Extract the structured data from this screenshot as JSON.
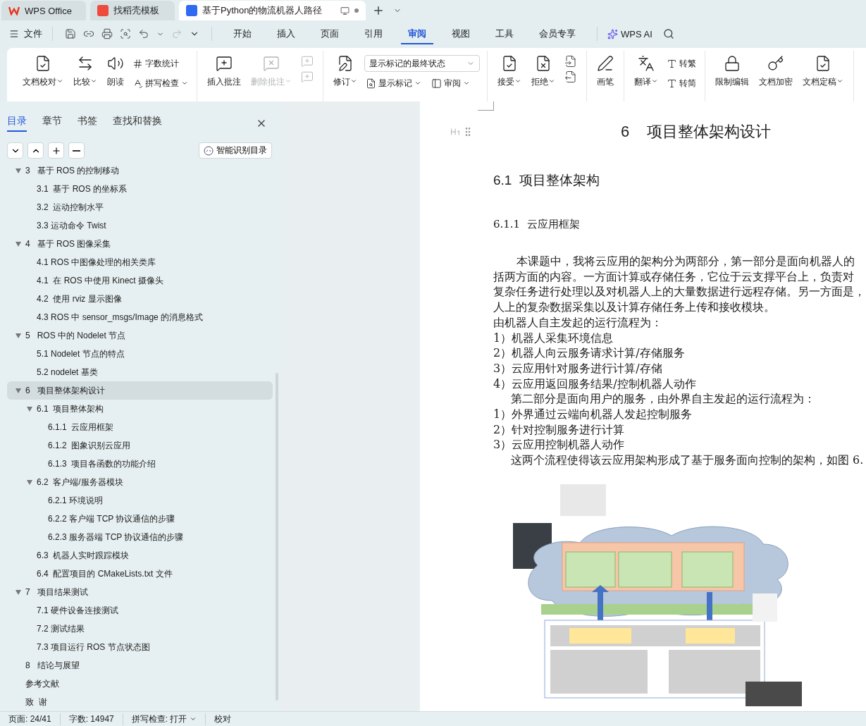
{
  "title_tabs": [
    {
      "kind": "home",
      "label": "WPS Office",
      "selected": false
    },
    {
      "kind": "template",
      "label": "找稻壳模板",
      "selected": false
    },
    {
      "kind": "document",
      "label": "基于Python的物流机器人路径",
      "selected": true
    }
  ],
  "menu": {
    "file": "文件",
    "tabs": [
      {
        "label": "开始",
        "selected": false
      },
      {
        "label": "插入",
        "selected": false
      },
      {
        "label": "页面",
        "selected": false
      },
      {
        "label": "引用",
        "selected": false
      },
      {
        "label": "审阅",
        "selected": true
      },
      {
        "label": "视图",
        "selected": false
      },
      {
        "label": "工具",
        "selected": false
      },
      {
        "label": "会员专享",
        "selected": false
      }
    ],
    "ai": "WPS AI"
  },
  "ribbon": [
    {
      "items": [
        {
          "kind": "large",
          "label": "文档校对",
          "dropdown": true,
          "disabled": false
        },
        {
          "kind": "large",
          "label": "比较",
          "dropdown": true,
          "disabled": false
        },
        {
          "kind": "large",
          "label": "朗读",
          "dropdown": false,
          "disabled": false
        },
        {
          "kind": "stack",
          "items": [
            {
              "kind": "small",
              "label": "字数统计",
              "dropdown": false,
              "disabled": false
            },
            {
              "kind": "small",
              "label": "拼写检查",
              "dropdown": true,
              "disabled": false
            }
          ]
        }
      ]
    },
    {
      "items": [
        {
          "kind": "large",
          "label": "插入批注",
          "dropdown": false,
          "disabled": false
        },
        {
          "kind": "large",
          "label": "删除批注",
          "dropdown": true,
          "disabled": true
        },
        {
          "kind": "stack",
          "items": [
            {
              "kind": "icon",
              "disabled": true
            },
            {
              "kind": "icon",
              "disabled": true
            }
          ]
        }
      ]
    },
    {
      "items": [
        {
          "kind": "large",
          "label": "修订",
          "dropdown": true,
          "disabled": false
        },
        {
          "kind": "stack",
          "items": [
            {
              "kind": "select",
              "label": "显示标记的最终状态"
            },
            {
              "kind": "row",
              "items": [
                {
                  "kind": "small",
                  "label": "显示标记",
                  "dropdown": true,
                  "disabled": false
                },
                {
                  "kind": "small",
                  "label": "审阅",
                  "dropdown": true,
                  "disabled": false
                }
              ]
            }
          ]
        }
      ]
    },
    {
      "items": [
        {
          "kind": "large",
          "label": "接受",
          "dropdown": true,
          "disabled": false
        },
        {
          "kind": "large",
          "label": "拒绝",
          "dropdown": true,
          "disabled": false
        },
        {
          "kind": "stack",
          "items": [
            {
              "kind": "icon",
              "disabled": false
            },
            {
              "kind": "icon",
              "disabled": false
            }
          ]
        }
      ]
    },
    {
      "items": [
        {
          "kind": "large",
          "label": "画笔",
          "dropdown": false,
          "disabled": false
        }
      ]
    },
    {
      "items": [
        {
          "kind": "large",
          "label": "翻译",
          "dropdown": true,
          "disabled": false
        },
        {
          "kind": "stack",
          "items": [
            {
              "kind": "small",
              "label": "转繁",
              "dropdown": false,
              "disabled": false
            },
            {
              "kind": "small",
              "label": "转简",
              "dropdown": false,
              "disabled": false
            }
          ]
        }
      ]
    },
    {
      "items": [
        {
          "kind": "large",
          "label": "限制编辑",
          "dropdown": false,
          "disabled": false
        },
        {
          "kind": "large",
          "label": "文档加密",
          "dropdown": false,
          "disabled": false
        },
        {
          "kind": "large",
          "label": "文档定稿",
          "dropdown": true,
          "disabled": false
        }
      ]
    }
  ],
  "sidebar": {
    "tabs": [
      {
        "label": "目录",
        "selected": true
      },
      {
        "label": "章节",
        "selected": false
      },
      {
        "label": "书签",
        "selected": false
      },
      {
        "label": "查找和替换",
        "selected": false
      }
    ],
    "smart_button": "智能识别目录",
    "outline": [
      {
        "label": "3   基于 ROS 的控制移动",
        "selected": false,
        "expanded": true,
        "children": [
          {
            "label": "3.1  基于 ROS 的坐标系",
            "selected": false
          },
          {
            "label": "3.2  运动控制水平",
            "selected": false
          },
          {
            "label": "3.3 运动命令 Twist",
            "selected": false
          }
        ]
      },
      {
        "label": "4   基于 ROS 图像采集",
        "selected": false,
        "expanded": true,
        "children": [
          {
            "label": "4.1 ROS 中图像处理的相关类库",
            "selected": false
          },
          {
            "label": "4.1  在 ROS 中使用 Kinect 摄像头",
            "selected": false
          },
          {
            "label": "4.2  使用 rviz 显示图像",
            "selected": false
          },
          {
            "label": "4.3 ROS 中 sensor_msgs/Image 的消息格式",
            "selected": false
          }
        ]
      },
      {
        "label": "5   ROS 中的 Nodelet 节点",
        "selected": false,
        "expanded": true,
        "children": [
          {
            "label": "5.1 Nodelet 节点的特点",
            "selected": false
          },
          {
            "label": "5.2 nodelet 基类",
            "selected": false
          }
        ]
      },
      {
        "label": "6   项目整体架构设计",
        "selected": true,
        "expanded": true,
        "children": [
          {
            "label": "6.1  项目整体架构",
            "selected": false,
            "expanded": true,
            "children": [
              {
                "label": "6.1.1  云应用框架",
                "selected": false
              },
              {
                "label": "6.1.2  图象识别云应用",
                "selected": false
              },
              {
                "label": "6.1.3  项目各函数的功能介绍",
                "selected": false
              }
            ]
          },
          {
            "label": "6.2  客户端/服务器模块",
            "selected": false,
            "expanded": true,
            "children": [
              {
                "label": "6.2.1 环境说明",
                "selected": false
              },
              {
                "label": "6.2.2 客户端 TCP 协议通信的步骤",
                "selected": false
              },
              {
                "label": "6.2.3 服务器端 TCP 协议通信的步骤",
                "selected": false
              }
            ]
          },
          {
            "label": "6.3  机器人实时跟踪模块",
            "selected": false
          },
          {
            "label": "6.4  配置项目的 CMakeLists.txt 文件",
            "selected": false
          }
        ]
      },
      {
        "label": "7   项目结果测试",
        "selected": false,
        "expanded": true,
        "children": [
          {
            "label": "7.1 硬件设备连接测试",
            "selected": false
          },
          {
            "label": "7.2 测试结果",
            "selected": false
          },
          {
            "label": "7.3 项目运行 ROS 节点状态图",
            "selected": false
          }
        ]
      },
      {
        "label": "8   结论与展望",
        "selected": false
      },
      {
        "label": "参考文献",
        "selected": false
      },
      {
        "label": "致  谢",
        "selected": false
      }
    ]
  },
  "document": {
    "chapter_title": "6    项目整体架构设计",
    "section_title": "6.1  项目整体架构",
    "subsection_title": "6.1.1  云应用框架",
    "lines": [
      {
        "kind": "indent",
        "text": "本课题中，我将云应用的架构分为两部分，第一部分是面向机器人的"
      },
      {
        "kind": "plain",
        "text": "括两方面的内容。一方面计算或存储任务，它位于云支撑平台上，负责对"
      },
      {
        "kind": "plain",
        "text": "复杂任务进行处理以及对机器人上的大量数据进行远程存储。另一方面是，"
      },
      {
        "kind": "plain",
        "text": "人上的复杂数据采集以及计算存储任务上传和接收模块。"
      },
      {
        "kind": "plain",
        "text": "由机器人自主发起的运行流程为："
      },
      {
        "kind": "plain",
        "text": "1）机器人采集环境信息"
      },
      {
        "kind": "plain",
        "text": "2）机器人向云服务请求计算/存储服务"
      },
      {
        "kind": "plain",
        "text": "3）云应用针对服务进行计算/存储"
      },
      {
        "kind": "plain",
        "text": "4）云应用返回服务结果/控制机器人动作"
      },
      {
        "kind": "hanging",
        "text": "第二部分是面向用户的服务，由外界自主发起的运行流程为："
      },
      {
        "kind": "plain",
        "text": "1）外界通过云端向机器人发起控制服务"
      },
      {
        "kind": "plain",
        "text": "2）针对控制服务进行计算"
      },
      {
        "kind": "plain",
        "text": "3）云应用控制机器人动作"
      },
      {
        "kind": "hanging",
        "text": "这两个流程使得该云应用架构形成了基于服务面向控制的架构，如图 6."
      }
    ]
  },
  "status_bar": {
    "page": "页面: 24/41",
    "words": "字数: 14947",
    "spell": "拼写检查: 打开",
    "proof": "校对"
  }
}
